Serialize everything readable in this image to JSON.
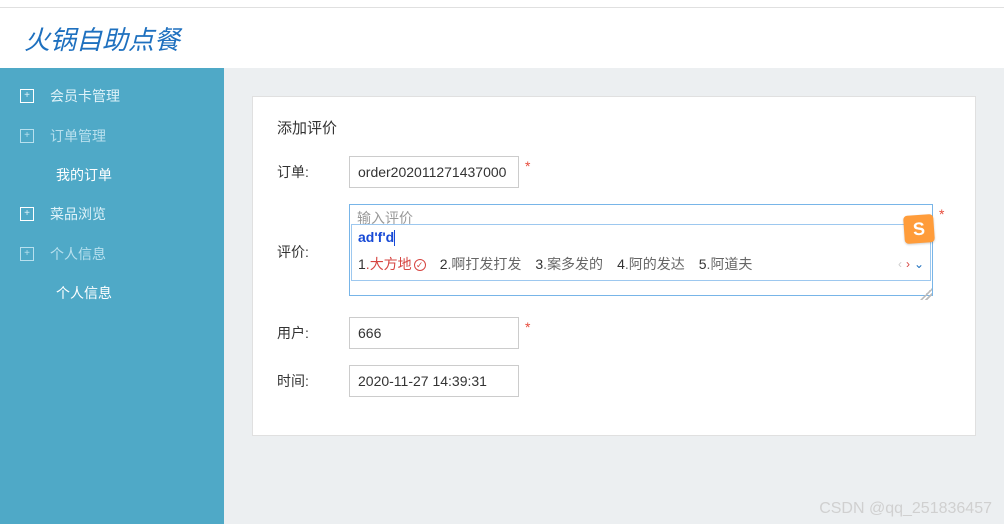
{
  "header": {
    "title": "火锅自助点餐"
  },
  "sidebar": {
    "items": [
      {
        "label": "会员卡管理",
        "type": "group"
      },
      {
        "label": "订单管理",
        "type": "group-muted"
      },
      {
        "label": "我的订单",
        "type": "sub"
      },
      {
        "label": "菜品浏览",
        "type": "group"
      },
      {
        "label": "个人信息",
        "type": "group-muted"
      },
      {
        "label": "个人信息",
        "type": "sub"
      }
    ]
  },
  "panel": {
    "title": "添加评价",
    "form": {
      "order_label": "订单:",
      "order_value": "order202011271437000",
      "review_label": "评价:",
      "review_placeholder": "输入评价",
      "user_label": "用户:",
      "user_value": "666",
      "time_label": "时间:",
      "time_value": "2020-11-27 14:39:31",
      "required_mark": "*"
    }
  },
  "ime": {
    "input": "ad'f'd",
    "candidates": [
      {
        "n": "1",
        "text": "大方地",
        "first": true
      },
      {
        "n": "2",
        "text": "啊打发打发"
      },
      {
        "n": "3",
        "text": "案多发的"
      },
      {
        "n": "4",
        "text": "阿的发达"
      },
      {
        "n": "5",
        "text": "阿道夫"
      }
    ],
    "logo": "S",
    "nav_prev": "‹",
    "nav_next": "›",
    "nav_down": "⌄"
  },
  "watermark": "CSDN @qq_251836457"
}
